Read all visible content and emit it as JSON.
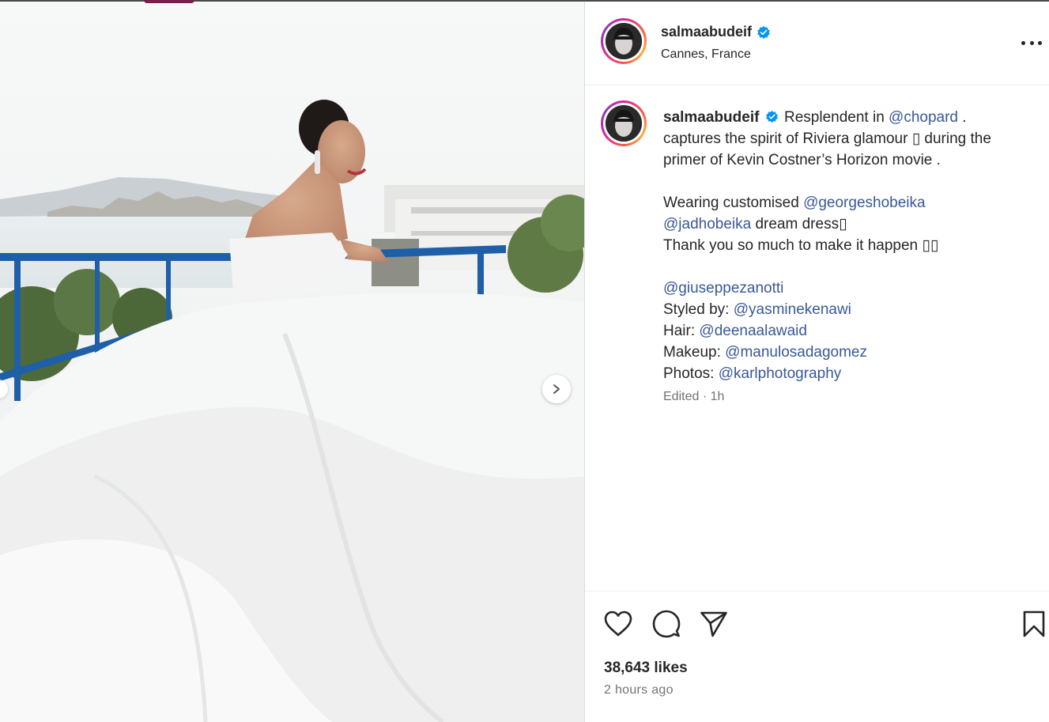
{
  "post": {
    "username": "salmaabudeif",
    "location": "Cannes, France",
    "verified": true
  },
  "caption": {
    "username": "salmaabudeif",
    "text_intro": "Resplendent in",
    "mention_chopard": "@chopard",
    "text_after_chopard": " .",
    "line2": "captures the spirit of Riviera glamour ▯ during the",
    "line3": "primer of Kevin Costner’s Horizon movie .",
    "line4_prefix": "Wearing customised",
    "mention_georges": "@georgeshobeika",
    "mention_jad": "@jadhobeika",
    "line5_suffix": " dream dress▯",
    "line6": "Thank you so much to make it happen ▯▯",
    "mention_giuseppe": "@giuseppezanotti",
    "styled_label": "Styled by: ",
    "mention_stylist": "@yasminekenawi",
    "hair_label": "Hair: ",
    "mention_hair": "@deenaalawaid",
    "makeup_label": "Makeup: ",
    "mention_makeup": "@manulosadagomez",
    "photos_label": "Photos: ",
    "mention_photos": "@karlphotography",
    "edited": "Edited",
    "edited_sep": " · ",
    "edited_time": "1h"
  },
  "stats": {
    "likes": "38,643 likes",
    "posted": "2 hours ago"
  },
  "icons": {
    "like": "heart-icon",
    "comment": "comment-bubble-icon",
    "share": "paper-plane-icon",
    "save": "bookmark-icon",
    "more": "more-options-icon",
    "next": "chevron-right-icon",
    "verified": "verified-badge-icon"
  },
  "colors": {
    "link": "#385898",
    "verified": "#0095f6",
    "muted": "#737373",
    "text": "#262626"
  }
}
